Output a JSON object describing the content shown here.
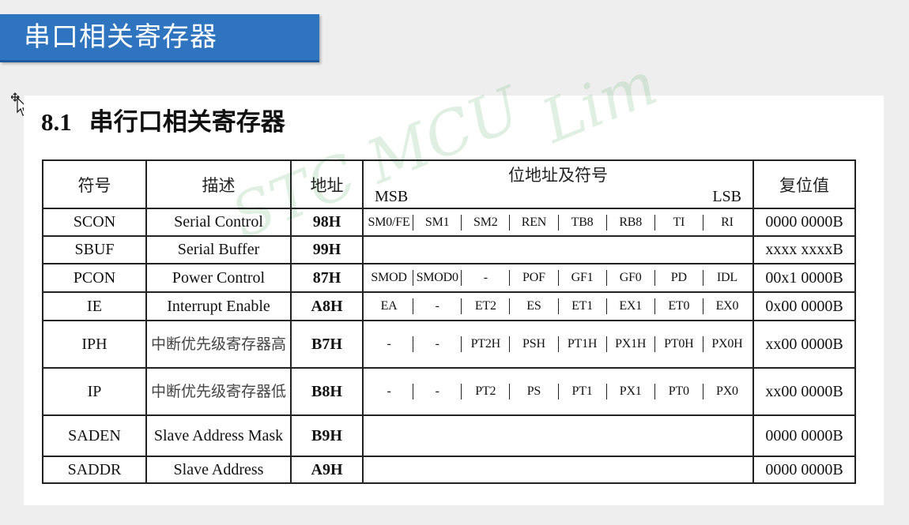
{
  "slide": {
    "title": "串口相关寄存器",
    "colors": {
      "title_bar": "#2e74bf",
      "title_text": "#ffffff",
      "background": "#eeeeee"
    }
  },
  "cursor": {
    "icon": "move-cursor-icon"
  },
  "document": {
    "section_number": "8.1",
    "section_title": "串行口相关寄存器",
    "watermark": {
      "brand": "STC MCU",
      "suffix": "Lim"
    },
    "table": {
      "headers": {
        "symbol": "符号",
        "description": "描述",
        "address": "地址",
        "bits": "位地址及符号",
        "msb": "MSB",
        "lsb": "LSB",
        "reset": "复位值"
      },
      "rows": [
        {
          "symbol": "SCON",
          "description": "Serial Control",
          "address": "98H",
          "bits": [
            "SM0/FE",
            "SM1",
            "SM2",
            "REN",
            "TB8",
            "RB8",
            "TI",
            "RI"
          ],
          "reset": "0000 0000B"
        },
        {
          "symbol": "SBUF",
          "description": "Serial Buffer",
          "address": "99H",
          "bits": [],
          "reset": "xxxx xxxxB"
        },
        {
          "symbol": "PCON",
          "description": "Power Control",
          "address": "87H",
          "bits": [
            "SMOD",
            "SMOD0",
            "-",
            "POF",
            "GF1",
            "GF0",
            "PD",
            "IDL"
          ],
          "reset": "00x1 0000B"
        },
        {
          "symbol": "IE",
          "description": "Interrupt Enable",
          "address": "A8H",
          "bits": [
            "EA",
            "-",
            "ET2",
            "ES",
            "ET1",
            "EX1",
            "ET0",
            "EX0"
          ],
          "reset": "0x00 0000B"
        },
        {
          "symbol": "IPH",
          "description": "中断优先级寄存器高",
          "address": "B7H",
          "bits": [
            "-",
            "-",
            "PT2H",
            "PSH",
            "PT1H",
            "PX1H",
            "PT0H",
            "PX0H"
          ],
          "reset": "xx00 0000B"
        },
        {
          "symbol": "IP",
          "description": "中断优先级寄存器低",
          "address": "B8H",
          "bits": [
            "-",
            "-",
            "PT2",
            "PS",
            "PT1",
            "PX1",
            "PT0",
            "PX0"
          ],
          "reset": "xx00 0000B"
        },
        {
          "symbol": "SADEN",
          "description": "Slave Address Mask",
          "address": "B9H",
          "bits": [],
          "reset": "0000 0000B"
        },
        {
          "symbol": "SADDR",
          "description": "Slave Address",
          "address": "A9H",
          "bits": [],
          "reset": "0000 0000B"
        }
      ]
    }
  }
}
